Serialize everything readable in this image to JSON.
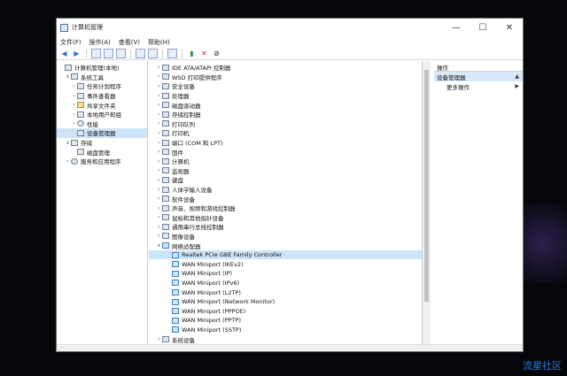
{
  "window": {
    "title": "计算机管理",
    "buttons": {
      "minimize": "—",
      "maximize": "☐",
      "close": "✕"
    }
  },
  "menu": [
    "文件(F)",
    "操作(A)",
    "查看(V)",
    "帮助(H)"
  ],
  "left_tree": [
    {
      "label": "计算机管理(本地)",
      "indent": 0,
      "arrow": "",
      "icon": "computer-icon"
    },
    {
      "label": "系统工具",
      "indent": 1,
      "arrow": "∨",
      "icon": "tools-icon"
    },
    {
      "label": "任务计划程序",
      "indent": 2,
      "arrow": "›",
      "icon": "clock-icon"
    },
    {
      "label": "事件查看器",
      "indent": 2,
      "arrow": "›",
      "icon": "event-icon"
    },
    {
      "label": "共享文件夹",
      "indent": 2,
      "arrow": "›",
      "icon": "folder-icon"
    },
    {
      "label": "本地用户和组",
      "indent": 2,
      "arrow": "›",
      "icon": "users-icon"
    },
    {
      "label": "性能",
      "indent": 2,
      "arrow": "›",
      "icon": "performance-icon"
    },
    {
      "label": "设备管理器",
      "indent": 2,
      "arrow": "",
      "icon": "device-manager-icon",
      "selected": true
    },
    {
      "label": "存储",
      "indent": 1,
      "arrow": "∨",
      "icon": "storage-icon"
    },
    {
      "label": "磁盘管理",
      "indent": 2,
      "arrow": "",
      "icon": "disk-icon"
    },
    {
      "label": "服务和应用程序",
      "indent": 1,
      "arrow": "›",
      "icon": "services-icon"
    }
  ],
  "device_tree": [
    {
      "label": "IDE ATA/ATAPI 控制器",
      "indent": 0,
      "arrow": "›",
      "icon": "ide-icon"
    },
    {
      "label": "WSD 打印提供程序",
      "indent": 0,
      "arrow": "›",
      "icon": "printer-icon"
    },
    {
      "label": "安全设备",
      "indent": 0,
      "arrow": "›",
      "icon": "security-icon"
    },
    {
      "label": "处理器",
      "indent": 0,
      "arrow": "›",
      "icon": "cpu-icon"
    },
    {
      "label": "磁盘驱动器",
      "indent": 0,
      "arrow": "›",
      "icon": "disk-icon"
    },
    {
      "label": "存储控制器",
      "indent": 0,
      "arrow": "›",
      "icon": "storage-icon"
    },
    {
      "label": "打印队列",
      "indent": 0,
      "arrow": "›",
      "icon": "printer-icon"
    },
    {
      "label": "打印机",
      "indent": 0,
      "arrow": "›",
      "icon": "printer-icon"
    },
    {
      "label": "端口 (COM 和 LPT)",
      "indent": 0,
      "arrow": "›",
      "icon": "port-icon"
    },
    {
      "label": "固件",
      "indent": 0,
      "arrow": "›",
      "icon": "firmware-icon"
    },
    {
      "label": "计算机",
      "indent": 0,
      "arrow": "›",
      "icon": "computer-icon"
    },
    {
      "label": "监视器",
      "indent": 0,
      "arrow": "›",
      "icon": "monitor-icon"
    },
    {
      "label": "键盘",
      "indent": 0,
      "arrow": "›",
      "icon": "keyboard-icon"
    },
    {
      "label": "人体学输入设备",
      "indent": 0,
      "arrow": "›",
      "icon": "hid-icon"
    },
    {
      "label": "软件设备",
      "indent": 0,
      "arrow": "›",
      "icon": "software-device-icon"
    },
    {
      "label": "声音、视频和游戏控制器",
      "indent": 0,
      "arrow": "›",
      "icon": "sound-icon"
    },
    {
      "label": "鼠标和其他指针设备",
      "indent": 0,
      "arrow": "›",
      "icon": "mouse-icon"
    },
    {
      "label": "通用串行总线控制器",
      "indent": 0,
      "arrow": "›",
      "icon": "usb-icon"
    },
    {
      "label": "图像设备",
      "indent": 0,
      "arrow": "›",
      "icon": "camera-icon"
    },
    {
      "label": "网络适配器",
      "indent": 0,
      "arrow": "∨",
      "icon": "network-icon"
    },
    {
      "label": "Realtek PCIe GBE Family Controller",
      "indent": 1,
      "arrow": "",
      "icon": "network-adapter-icon",
      "selected": true
    },
    {
      "label": "WAN Miniport (IKEv2)",
      "indent": 1,
      "arrow": "",
      "icon": "network-adapter-icon"
    },
    {
      "label": "WAN Miniport (IP)",
      "indent": 1,
      "arrow": "",
      "icon": "network-adapter-icon"
    },
    {
      "label": "WAN Miniport (IPv6)",
      "indent": 1,
      "arrow": "",
      "icon": "network-adapter-icon"
    },
    {
      "label": "WAN Miniport (L2TP)",
      "indent": 1,
      "arrow": "",
      "icon": "network-adapter-icon"
    },
    {
      "label": "WAN Miniport (Network Monitor)",
      "indent": 1,
      "arrow": "",
      "icon": "network-adapter-icon"
    },
    {
      "label": "WAN Miniport (PPPOE)",
      "indent": 1,
      "arrow": "",
      "icon": "network-adapter-icon"
    },
    {
      "label": "WAN Miniport (PPTP)",
      "indent": 1,
      "arrow": "",
      "icon": "network-adapter-icon"
    },
    {
      "label": "WAN Miniport (SSTP)",
      "indent": 1,
      "arrow": "",
      "icon": "network-adapter-icon"
    },
    {
      "label": "系统设备",
      "indent": 0,
      "arrow": "›",
      "icon": "system-device-icon"
    }
  ],
  "actions": {
    "header": "操作",
    "section": "设备管理器",
    "section_arrow": "▲",
    "more": "更多操作",
    "more_arrow": "▶"
  },
  "watermark": "流星社区"
}
